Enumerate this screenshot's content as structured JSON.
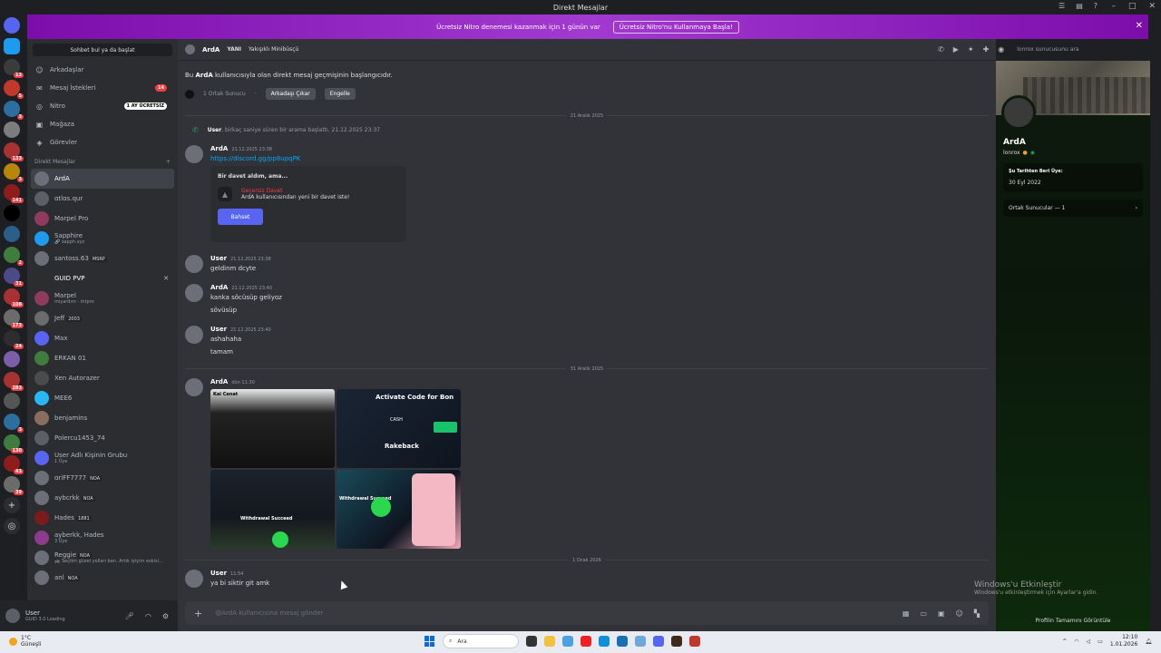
{
  "window": {
    "title": "Direkt Mesajlar"
  },
  "nitro_banner": {
    "text": "Ücretsiz Nitro denemesi kazanmak için 1 günün var",
    "cta": "Ücretsiz Nitro'nu Kullanmaya Başla!"
  },
  "servers": [
    {
      "color": "#5865f2",
      "badge": ""
    },
    {
      "color": "#1d9bf0",
      "badge": ""
    },
    {
      "color": "#3b3b3b",
      "badge": "13"
    },
    {
      "color": "#c0392b",
      "badge": "5"
    },
    {
      "color": "#2c6e9e",
      "badge": "3"
    },
    {
      "color": "#7d7d7d",
      "badge": ""
    },
    {
      "color": "#a83232",
      "badge": "133"
    },
    {
      "color": "#b8860b",
      "badge": "3"
    },
    {
      "color": "#8e1c1c",
      "badge": "141"
    },
    {
      "color": "#000000",
      "badge": ""
    },
    {
      "color": "#2c5e8a",
      "badge": ""
    },
    {
      "color": "#3e7d3e",
      "badge": "2"
    },
    {
      "color": "#4b4b8a",
      "badge": "31"
    },
    {
      "color": "#a83232",
      "badge": "108"
    },
    {
      "color": "#6b6b6b",
      "badge": "173"
    },
    {
      "color": "#2d2d2d",
      "badge": "24"
    },
    {
      "color": "#7b5ea7",
      "badge": ""
    },
    {
      "color": "#a83232",
      "badge": "283"
    },
    {
      "color": "#555555",
      "badge": ""
    },
    {
      "color": "#2c6e9e",
      "badge": "3"
    },
    {
      "color": "#3e7d3e",
      "badge": "130"
    },
    {
      "color": "#8e1c1c",
      "badge": "43"
    },
    {
      "color": "#6b6b6b",
      "badge": "39"
    }
  ],
  "sidebar": {
    "search_placeholder": "Sohbet bul ya da başlat",
    "nav": [
      {
        "label": "Arkadaşlar",
        "icon": "friends-icon",
        "glyph": "☺",
        "pill": ""
      },
      {
        "label": "Mesaj İstekleri",
        "icon": "envelope-icon",
        "glyph": "✉",
        "pill": "14"
      },
      {
        "label": "Nitro",
        "icon": "nitro-icon",
        "glyph": "◎",
        "pill": "1 AY ÜCRETSİZ"
      },
      {
        "label": "Mağaza",
        "icon": "shop-icon",
        "glyph": "▣",
        "pill": ""
      },
      {
        "label": "Görevler",
        "icon": "quests-icon",
        "glyph": "◈",
        "pill": ""
      }
    ],
    "dm_header": "Direkt Mesajlar",
    "dms": [
      {
        "name": "ArdA",
        "sub": "",
        "tag": "",
        "color": "#6d6f78",
        "active": true
      },
      {
        "name": "ɑtlɑs.ɋur",
        "sub": "",
        "tag": "",
        "color": "#5c5f66"
      },
      {
        "name": "Marpel Pro",
        "sub": "",
        "tag": "",
        "color": "#8e3b5e"
      },
      {
        "name": "Sapphire",
        "sub": "🔗 sapph.xyz",
        "tag": "",
        "color": "#1d9bf0"
      },
      {
        "name": "santoss.63",
        "sub": "",
        "tag": "MSRP",
        "color": "#6d6f78"
      },
      {
        "name": "GUID PVP",
        "sub": "",
        "tag": "",
        "color": "#2d2d2d",
        "close": true
      },
      {
        "name": "Marpel",
        "sub": "miyardım - mtpro",
        "tag": "",
        "color": "#8e3b5e"
      },
      {
        "name": "Jeff",
        "sub": "",
        "tag": "2003",
        "color": "#6b6b6b"
      },
      {
        "name": "Max",
        "sub": "",
        "tag": "",
        "color": "#5865f2"
      },
      {
        "name": "ERKAN 01",
        "sub": "",
        "tag": "",
        "color": "#3e7d3e"
      },
      {
        "name": "Xen Autorazer",
        "sub": "",
        "tag": "",
        "color": "#4b4b4b"
      },
      {
        "name": "MEE6",
        "sub": "",
        "tag": "",
        "color": "#29b6f6"
      },
      {
        "name": "benjamins",
        "sub": "",
        "tag": "",
        "color": "#8a6d5c"
      },
      {
        "name": "Polercu1453_74",
        "sub": "",
        "tag": "",
        "color": "#5c5f66"
      },
      {
        "name": "User Adlı Kişinin Grubu",
        "sub": "1 Üye",
        "tag": "",
        "color": "#5865f2"
      },
      {
        "name": "ɑriFF7777",
        "sub": "",
        "tag": "NOA",
        "color": "#6d6f78"
      },
      {
        "name": "aybcrkk",
        "sub": "",
        "tag": "NOA",
        "color": "#6d6f78"
      },
      {
        "name": "Hades",
        "sub": "",
        "tag": "1881",
        "color": "#7b1c1c"
      },
      {
        "name": "ayberkk, Hades",
        "sub": "3 Üye",
        "tag": "",
        "color": "#8e3b8e"
      },
      {
        "name": "Reggie",
        "sub": "🚓 Seçtim güzel yolları ben. Artık iyiyim eskisi...",
        "tag": "NOA",
        "color": "#6d6f78"
      },
      {
        "name": "anl",
        "sub": "",
        "tag": "NOA",
        "color": "#6d6f78"
      }
    ]
  },
  "user_panel": {
    "name": "User",
    "sub": "GUID 3.0 Loading"
  },
  "chat": {
    "header": {
      "name": "ArdA",
      "status_label": "YANI",
      "status": "Yakışıklı Minibüsçü",
      "search_placeholder": "lonrox sunucusunu ara"
    },
    "intro": {
      "prefix": "Bu ",
      "name": "ArdA",
      "suffix": " kullanıcısıyla olan direkt mesaj geçmişinin başlangıcıdır.",
      "mutual": "1 Ortak Sunucu",
      "remove_friend": "Arkadaşı Çıkar",
      "block": "Engelle"
    },
    "dividers": [
      "21 Aralık 2025",
      "31 Aralık 2025",
      "1 Ocak 2026"
    ],
    "call": {
      "user": "User",
      "text": ", birkaç saniye süren bir arama başlattı.",
      "ts": "21.12.2025 23:37"
    },
    "messages": [
      {
        "author": "ArdA",
        "ts": "21.12.2025 23:38",
        "lines": [
          "https://discord.gg/pp8upqPK"
        ]
      },
      {
        "author": "User",
        "ts": "21.12.2025 23:38",
        "lines": [
          "geldinm dcyte"
        ]
      },
      {
        "author": "ArdA",
        "ts": "21.12.2025 23:40",
        "lines": [
          "kanka söcüsüp geliyoz",
          "sövüsüp"
        ]
      },
      {
        "author": "User",
        "ts": "21.12.2025 23:40",
        "lines": [
          "ashahaha",
          "tamam"
        ]
      },
      {
        "author": "ArdA",
        "ts": "dün 11:30",
        "lines": []
      },
      {
        "author": "User",
        "ts": "11:54",
        "lines": [
          "ya bi siktir git amk"
        ]
      }
    ],
    "invite": {
      "title": "Bir davet aldım, ama...",
      "invalid": "Geçersiz Davet",
      "desc": "ArdA kullanıcısından yeni bir davet iste!",
      "button": "Bahset"
    },
    "gallery": {
      "t1": "Kai Cenat",
      "t2": "Activate Code for Bon",
      "t2b": "CASH",
      "t2c": "Rakeback",
      "t3": "Withdrawal Succeed",
      "t4": "Withdrawal Succeed"
    },
    "composer_placeholder": "@ArdA kullanıcısına mesaj gönder"
  },
  "activation": {
    "title": "Windows'u Etkinleştir",
    "sub": "Windows'u etkinleştirmek için Ayarlar'a gidin."
  },
  "profile": {
    "name": "ArdA",
    "username": "lonrox",
    "member_since_label": "Şu Tarihten Beri Üye:",
    "member_since": "30 Eyl 2022",
    "mutual_servers": "Ortak Sunucular — 1",
    "footer": "Profilin Tamamını Görüntüle"
  },
  "taskbar": {
    "weather_temp": "1°C",
    "weather_desc": "Güneşli",
    "search": "Ara",
    "time": "12:10",
    "date": "1.01.2026"
  },
  "colors": {
    "accent": "#5865f2",
    "danger": "#f23f43",
    "online": "#23a55a",
    "link": "#00a8fc"
  }
}
